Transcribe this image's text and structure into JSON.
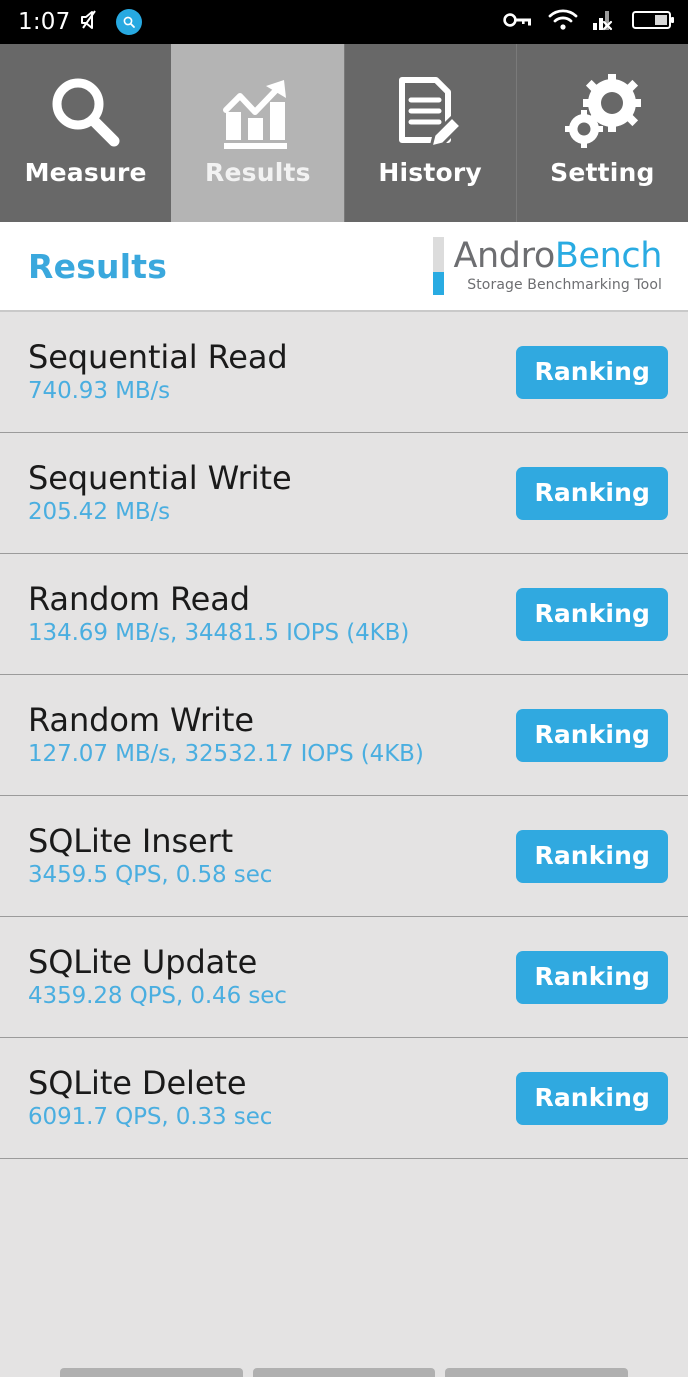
{
  "status_bar": {
    "time": "1:07",
    "left_icons": [
      "mute-icon",
      "search-badge-icon"
    ],
    "right_icons": [
      "vpn-key-icon",
      "wifi-icon",
      "cellular-signal-off-icon",
      "battery-icon"
    ],
    "background": "#000000"
  },
  "tabs": [
    {
      "label": "Measure",
      "icon": "magnifier-icon",
      "active": false
    },
    {
      "label": "Results",
      "icon": "bar-chart-arrow-icon",
      "active": true
    },
    {
      "label": "History",
      "icon": "document-pencil-icon",
      "active": false
    },
    {
      "label": "Setting",
      "icon": "gears-icon",
      "active": false
    }
  ],
  "header": {
    "title": "Results",
    "title_color": "#3aa8dd",
    "logo": {
      "word_part1": "Andro",
      "word_part2": "Bench",
      "tagline": "Storage Benchmarking Tool",
      "part1_color": "#6d6e71",
      "part2_color": "#29abe2"
    }
  },
  "results": {
    "button_label": "Ranking",
    "button_color": "#30a9e0",
    "value_color": "#4aaee0",
    "rows": [
      {
        "title": "Sequential Read",
        "value": "740.93 MB/s",
        "action": "Ranking"
      },
      {
        "title": "Sequential Write",
        "value": "205.42 MB/s",
        "action": "Ranking"
      },
      {
        "title": "Random Read",
        "value": "134.69 MB/s, 34481.5 IOPS (4KB)",
        "action": "Ranking"
      },
      {
        "title": "Random Write",
        "value": "127.07 MB/s, 32532.17 IOPS (4KB)",
        "action": "Ranking"
      },
      {
        "title": "SQLite Insert",
        "value": "3459.5 QPS, 0.58 sec",
        "action": "Ranking"
      },
      {
        "title": "SQLite Update",
        "value": "4359.28 QPS, 0.46 sec",
        "action": "Ranking"
      },
      {
        "title": "SQLite Delete",
        "value": "6091.7 QPS, 0.33 sec",
        "action": "Ranking"
      }
    ]
  },
  "nav_stub": {
    "items": [
      "recents-button",
      "home-button",
      "back-button"
    ]
  }
}
